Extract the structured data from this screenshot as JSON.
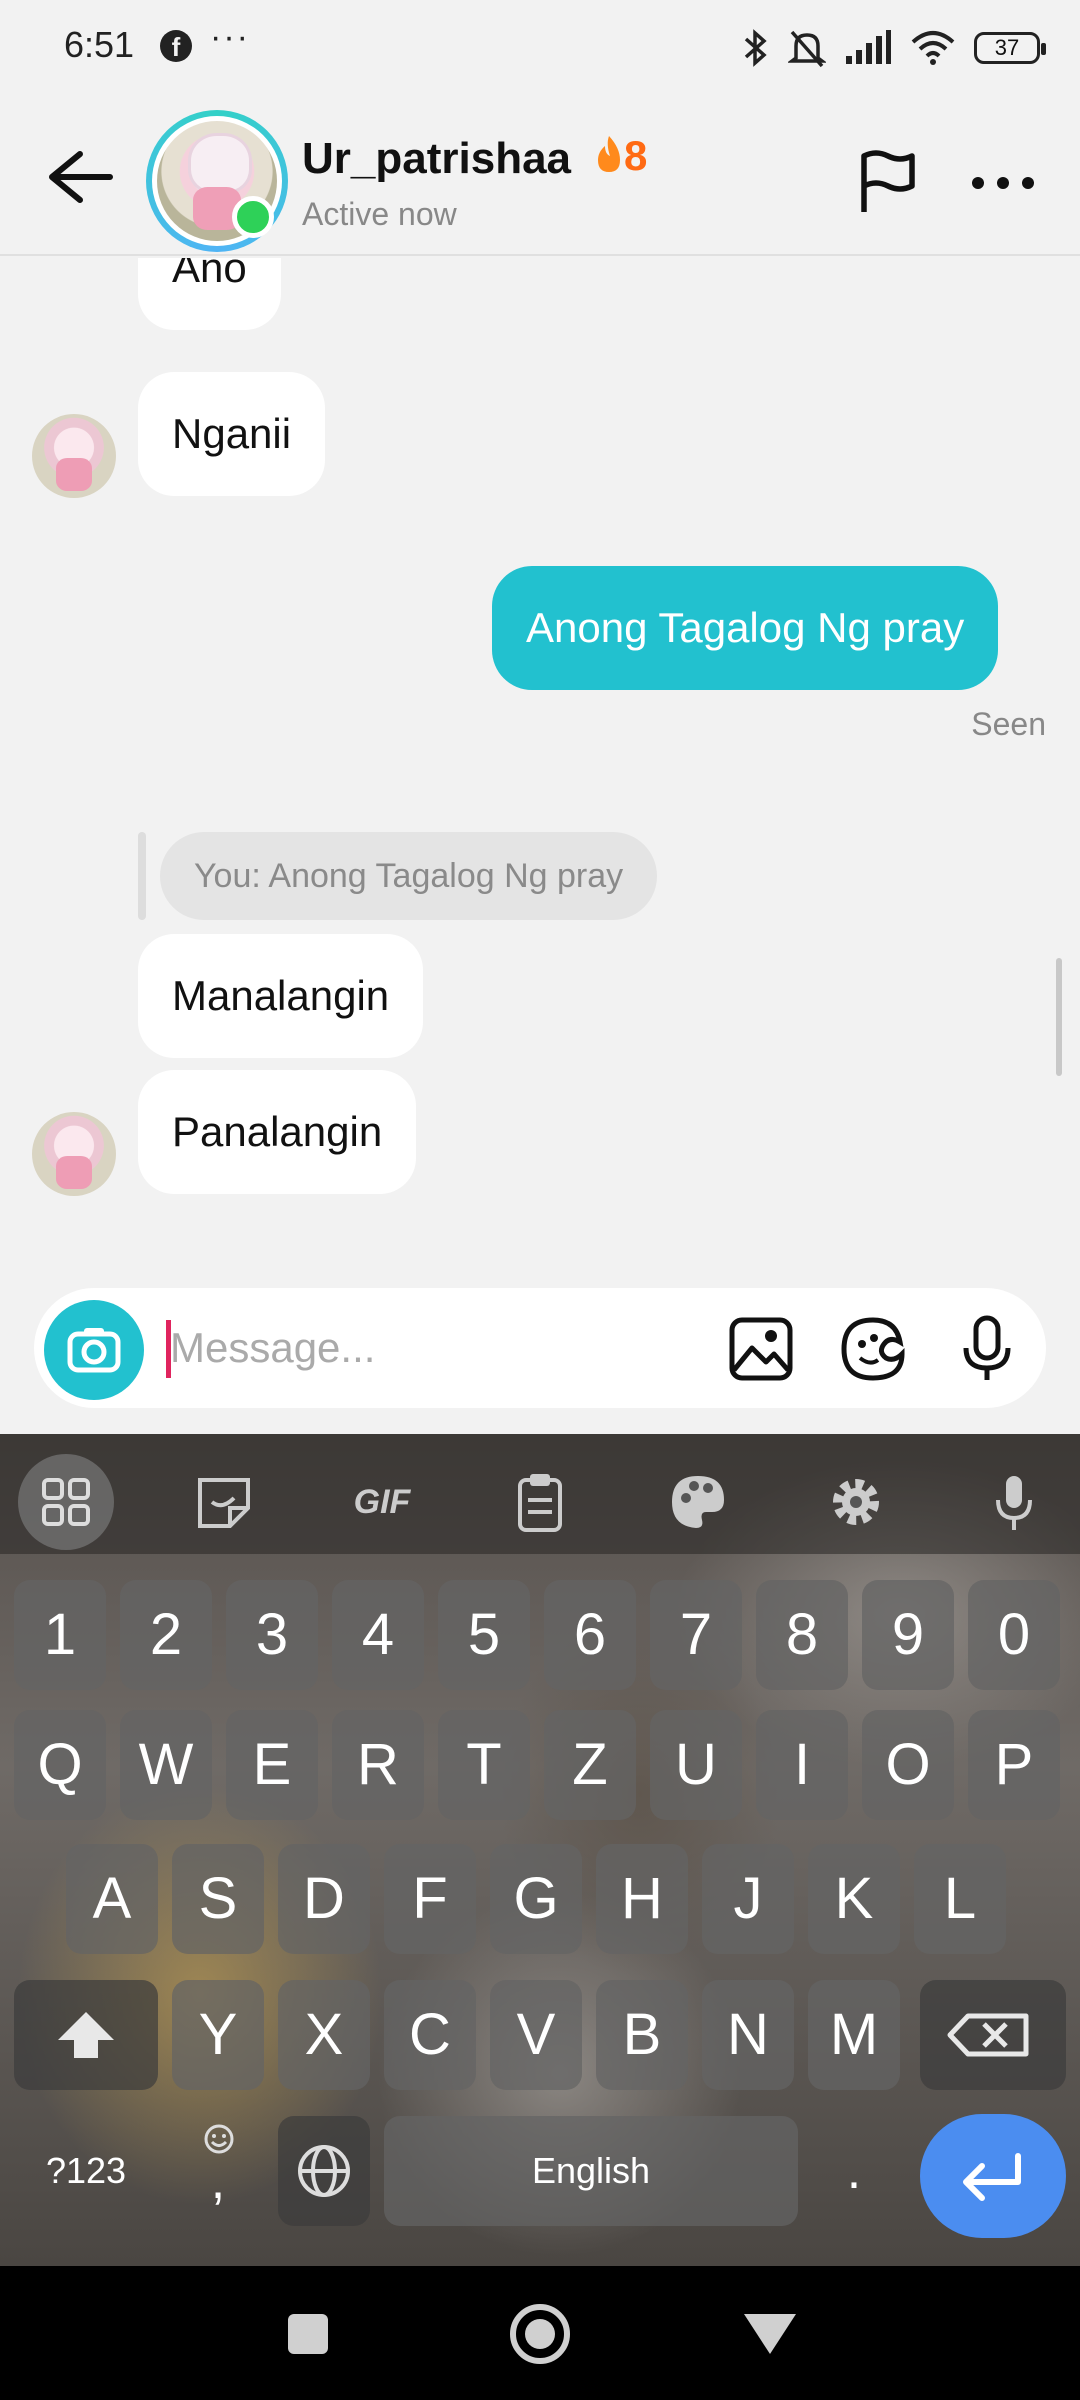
{
  "status_bar": {
    "time": "6:51",
    "battery": "37"
  },
  "header": {
    "username": "Ur_patrishaa",
    "streak": "8",
    "status": "Active now"
  },
  "messages": [
    {
      "text": "Ano"
    },
    {
      "text": "Nganii"
    },
    {
      "text": "Anong Tagalog Ng pray"
    },
    {
      "text": "Manalangin"
    },
    {
      "text": "Panalangin"
    }
  ],
  "seen_label": "Seen",
  "reply_preview": "You: Anong Tagalog Ng pray",
  "composer": {
    "placeholder": "Message...",
    "value": ""
  },
  "keyboard": {
    "toolbar": {
      "gif": "GIF"
    },
    "number_row": [
      "1",
      "2",
      "3",
      "4",
      "5",
      "6",
      "7",
      "8",
      "9",
      "0"
    ],
    "row1": [
      "Q",
      "W",
      "E",
      "R",
      "T",
      "Z",
      "U",
      "I",
      "O",
      "P"
    ],
    "row2": [
      "A",
      "S",
      "D",
      "F",
      "G",
      "H",
      "J",
      "K",
      "L"
    ],
    "row3": [
      "Y",
      "X",
      "C",
      "V",
      "B",
      "N",
      "M"
    ],
    "symbols": "?123",
    "comma": ",",
    "space": "English",
    "period": "."
  },
  "colors": {
    "accent": "#22c1cf",
    "online": "#2ed158",
    "streak": "#ff6a13",
    "enter": "#4b8df0"
  }
}
